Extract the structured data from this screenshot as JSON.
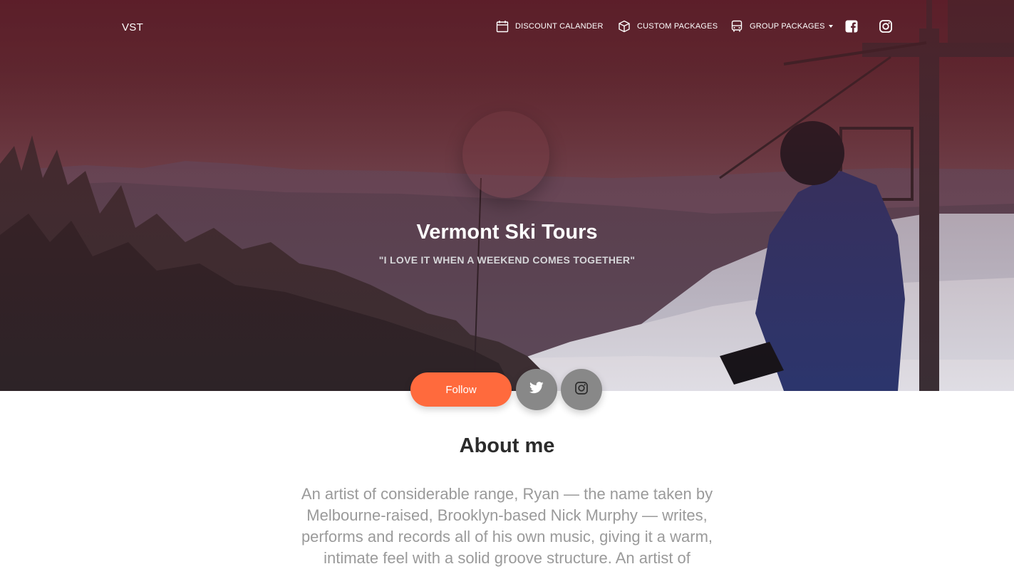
{
  "brand": "VST",
  "nav": {
    "items": [
      {
        "label": "DISCOUNT CALANDER",
        "icon": "calendar-icon"
      },
      {
        "label": "CUSTOM PACKAGES",
        "icon": "package-icon"
      },
      {
        "label": "GROUP PACKAGES",
        "icon": "bus-icon"
      }
    ],
    "social": [
      {
        "icon": "facebook-icon"
      },
      {
        "icon": "instagram-icon"
      }
    ]
  },
  "hero": {
    "title": "Vermont Ski Tours",
    "subtitle": "\"I LOVE IT WHEN A WEEKEND COMES TOGETHER\""
  },
  "actions": {
    "follow_label": "Follow",
    "twitter_icon": "twitter-icon",
    "instagram_icon": "instagram-icon"
  },
  "about": {
    "title": "About me",
    "text": "An artist of considerable range, Ryan — the name taken by Melbourne-raised, Brooklyn-based Nick Murphy — writes, performs and records all of his own music, giving it a warm, intimate feel with a solid groove structure. An artist of"
  },
  "colors": {
    "accent": "#ff6a3d",
    "round_button": "#888888",
    "hero_overlay": "#5e2531"
  }
}
